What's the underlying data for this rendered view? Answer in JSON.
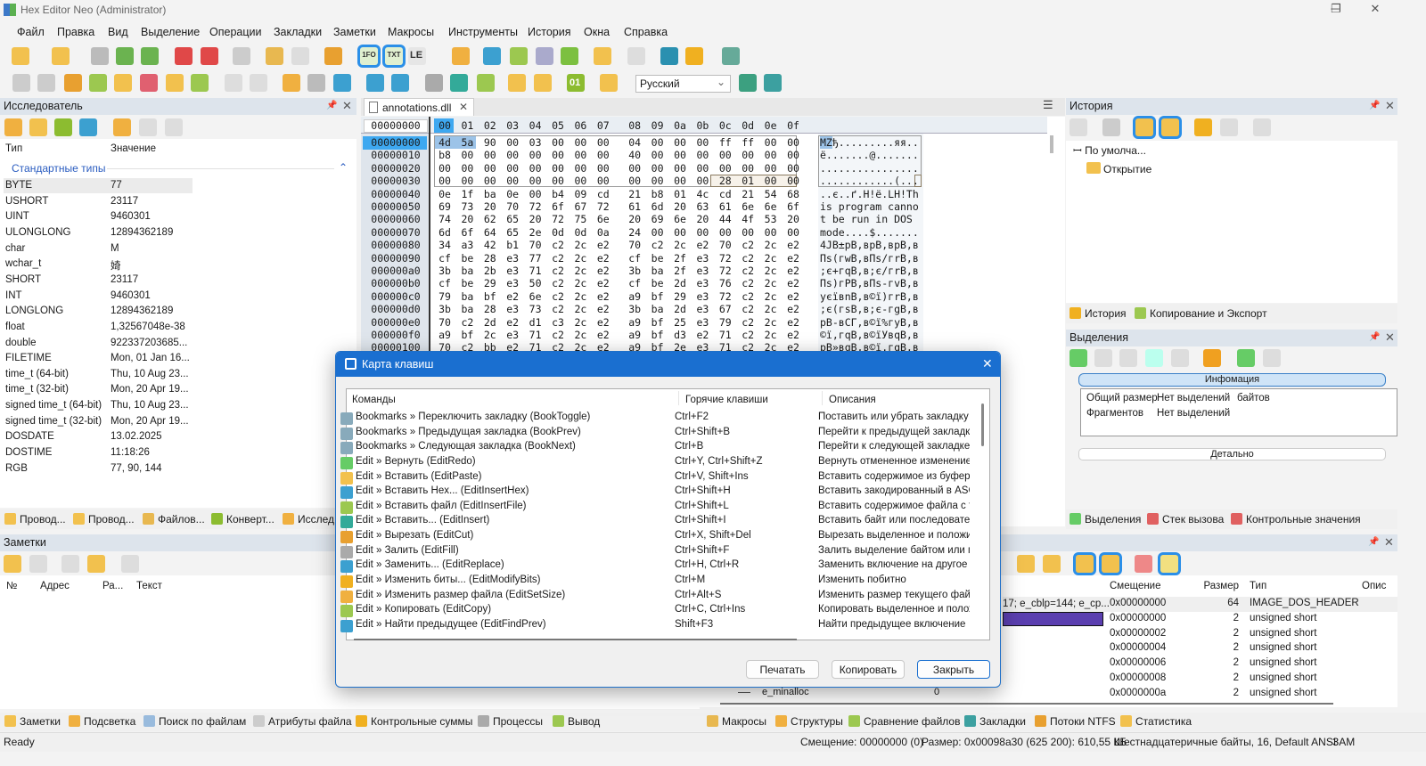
{
  "window": {
    "title": "Hex Editor Neo (Administrator)",
    "minimize": "─",
    "maximize": "❐",
    "close": "✕"
  },
  "menu": [
    "Файл",
    "Правка",
    "Вид",
    "Выделение",
    "Операции",
    "Закладки",
    "Заметки",
    "Макросы",
    "Инструменты",
    "История",
    "Окна",
    "Справка"
  ],
  "toolbar": {
    "language": "Русский",
    "chevron": "⌄",
    "btn_1fo": "1FO",
    "btn_txt": "TXT",
    "btn_le": "LE",
    "btn_bits": "01"
  },
  "explorer": {
    "title": "Исследователь",
    "col_type": "Тип",
    "col_value": "Значение",
    "group": "Стандартные типы",
    "collapse": "⌃",
    "rows": [
      [
        "BYTE",
        "77"
      ],
      [
        "USHORT",
        "23117"
      ],
      [
        "UINT",
        "9460301"
      ],
      [
        "ULONGLONG",
        "12894362189"
      ],
      [
        "char",
        "M"
      ],
      [
        "wchar_t",
        "婍"
      ],
      [
        "SHORT",
        "23117"
      ],
      [
        "INT",
        "9460301"
      ],
      [
        "LONGLONG",
        "12894362189"
      ],
      [
        "float",
        "1,32567048e-38"
      ],
      [
        "double",
        "922337203685..."
      ],
      [
        "FILETIME",
        "Mon, 01 Jan 16..."
      ],
      [
        "time_t (64-bit)",
        "Thu, 10 Aug 23..."
      ],
      [
        "time_t (32-bit)",
        "Mon, 20 Apr 19..."
      ],
      [
        "signed time_t (64-bit)",
        "Thu, 10 Aug 23..."
      ],
      [
        "signed time_t (32-bit)",
        "Mon, 20 Apr 19..."
      ],
      [
        "DOSDATE",
        "13.02.2025"
      ],
      [
        "DOSTIME",
        "11:18:26"
      ],
      [
        "RGB",
        "77, 90, 144"
      ]
    ],
    "tabs": [
      "Провод...",
      "Провод...",
      "Файлов...",
      "Конверт...",
      "Исслед"
    ]
  },
  "notes": {
    "title": "Заметки",
    "cols": [
      "№",
      "Адрес",
      "Ра...",
      "Текст"
    ]
  },
  "editor": {
    "tab": "annotations.dll",
    "tab_close": "✕",
    "offset_header": "00000000",
    "col_headers": [
      "00",
      "01",
      "02",
      "03",
      "04",
      "05",
      "06",
      "07",
      "08",
      "09",
      "0a",
      "0b",
      "0c",
      "0d",
      "0e",
      "0f"
    ],
    "rows": [
      [
        "00000000",
        "4d 5a 90 00 03 00 00 00 04 00 00 00 ff ff 00 00",
        "MZђ.........яя.."
      ],
      [
        "00000010",
        "b8 00 00 00 00 00 00 00 40 00 00 00 00 00 00 00",
        "ё.......@......."
      ],
      [
        "00000020",
        "00 00 00 00 00 00 00 00 00 00 00 00 00 00 00 00",
        "................"
      ],
      [
        "00000030",
        "00 00 00 00 00 00 00 00 00 00 00 00 28 01 00 00",
        "............(..."
      ],
      [
        "00000040",
        "0e 1f ba 0e 00 b4 09 cd 21 b8 01 4c cd 21 54 68",
        "..є..ґ.Н!ё.LН!Th"
      ],
      [
        "00000050",
        "69 73 20 70 72 6f 67 72 61 6d 20 63 61 6e 6e 6f",
        "is program canno"
      ],
      [
        "00000060",
        "74 20 62 65 20 72 75 6e 20 69 6e 20 44 4f 53 20",
        "t be run in DOS "
      ],
      [
        "00000070",
        "6d 6f 64 65 2e 0d 0d 0a 24 00 00 00 00 00 00 00",
        "mode....$......."
      ],
      [
        "00000080",
        "34 a3 42 b1 70 c2 2c e2 70 c2 2c e2 70 c2 2c e2",
        "4ЈB±pВ,вpВ,вpВ,в"
      ],
      [
        "00000090",
        "cf be 28 e3 77 c2 2c e2 cf be 2f e3 72 c2 2c e2",
        "Пѕ(гwВ,вПѕ/гrВ,в"
      ],
      [
        "000000a0",
        "3b ba 2b e3 71 c2 2c e2 3b ba 2f e3 72 c2 2c e2",
        ";є+гqВ,в;є/гrВ,в"
      ],
      [
        "000000b0",
        "cf be 29 e3 50 c2 2c e2 cf be 2d e3 76 c2 2c e2",
        "Пѕ)гPВ,вПѕ-гvВ,в"
      ],
      [
        "000000c0",
        "79 ba bf e2 6e c2 2c e2 a9 bf 29 e3 72 c2 2c e2",
        "yєївnВ,в©ї)гrВ,в"
      ],
      [
        "000000d0",
        "3b ba 28 e3 73 c2 2c e2 3b ba 2d e3 67 c2 2c e2",
        ";є(гsВ,в;є-гgВ,в"
      ],
      [
        "000000e0",
        "70 c2 2d e2 d1 c3 2c e2 a9 bf 25 e3 79 c2 2c e2",
        "pВ-вСГ,в©ї%гyВ,в"
      ],
      [
        "000000f0",
        "a9 bf 2c e3 71 c2 2c e2 a9 bf d3 e2 71 c2 2c e2",
        "©ї,гqВ,в©їУвqВ,в"
      ],
      [
        "00000100",
        "70 c2 bb e2 71 c2 2c e2 a9 bf 2e e3 71 c2 2c e2",
        "pВ»вqВ,в©ї.гqВ,в"
      ]
    ]
  },
  "history": {
    "title": "История",
    "root": "По умолча...",
    "item": "Открытие",
    "tabs": [
      "История",
      "Копирование и Экспорт"
    ]
  },
  "selections": {
    "title": "Выделения",
    "info": "Инфомация",
    "rows": [
      [
        "Общий размер",
        "Нет выделений",
        "байтов"
      ],
      [
        "Фрагментов",
        "Нет выделений",
        ""
      ]
    ],
    "detail": "Детально",
    "tabs": [
      "Выделения",
      "Стек вызова",
      "Контрольные значения"
    ]
  },
  "structures": {
    "cols": [
      "Смещение",
      "Размер",
      "Тип",
      "Опис"
    ],
    "first_value": "17; e_cblp=144; e_cp...",
    "hidden_name": "e_minalloc",
    "hidden_value": "0",
    "rows": [
      [
        "0x00000000",
        "64",
        "IMAGE_DOS_HEADER"
      ],
      [
        "0x00000000",
        "2",
        "unsigned short"
      ],
      [
        "0x00000002",
        "2",
        "unsigned short"
      ],
      [
        "0x00000004",
        "2",
        "unsigned short"
      ],
      [
        "0x00000006",
        "2",
        "unsigned short"
      ],
      [
        "0x00000008",
        "2",
        "unsigned short"
      ],
      [
        "0x0000000a",
        "2",
        "unsigned short"
      ]
    ]
  },
  "bottom_tabs_left": [
    "Заметки",
    "Подсветка",
    "Поиск по файлам",
    "Атрибуты файла",
    "Контрольные суммы",
    "Процессы",
    "Вывод"
  ],
  "bottom_tabs_right": [
    "Макросы",
    "Структуры",
    "Сравнение файлов",
    "Закладки",
    "Потоки NTFS",
    "Статистика"
  ],
  "status": {
    "left": "Ready",
    "offset": "Смещение: 00000000 (0)",
    "size": "Размер: 0x00098a30 (625 200): 610,55 КБ",
    "mode": "Шестнадцатеричные байты, 16, Default ANSI",
    "ins": "ЗАМ"
  },
  "dialog": {
    "title": "Карта клавиш",
    "close": "✕",
    "cols": [
      "Команды",
      "Горячие клавиши",
      "Описания"
    ],
    "rows": [
      [
        "Bookmarks » Переключить закладку (BookToggle)",
        "Ctrl+F2",
        "Поставить или убрать закладку"
      ],
      [
        "Bookmarks » Предыдущая закладка (BookPrev)",
        "Ctrl+Shift+B",
        "Перейти к предыдущей закладк"
      ],
      [
        "Bookmarks » Следующая закладка (BookNext)",
        "Ctrl+B",
        "Перейти к следующей закладке"
      ],
      [
        "Edit » Вернуть (EditRedo)",
        "Ctrl+Y, Ctrl+Shift+Z",
        "Вернуть отмененное изменение"
      ],
      [
        "Edit » Вставить (EditPaste)",
        "Ctrl+V, Shift+Ins",
        "Вставить содержимое из буфера"
      ],
      [
        "Edit » Вставить Hex... (EditInsertHex)",
        "Ctrl+Shift+H",
        "Вставить закодированный в ASC"
      ],
      [
        "Edit » Вставить файл (EditInsertFile)",
        "Ctrl+Shift+L",
        "Вставить содержимое файла с те"
      ],
      [
        "Edit » Вставить... (EditInsert)",
        "Ctrl+Shift+I",
        "Вставить байт или последовате"
      ],
      [
        "Edit » Вырезать (EditCut)",
        "Ctrl+X, Shift+Del",
        "Вырезать выделенное и положи"
      ],
      [
        "Edit » Залить (EditFill)",
        "Ctrl+Shift+F",
        "Залить выделение байтом или п"
      ],
      [
        "Edit » Заменить... (EditReplace)",
        "Ctrl+H, Ctrl+R",
        "Заменить включение на другое"
      ],
      [
        "Edit » Изменить биты... (EditModifyBits)",
        "Ctrl+M",
        "Изменить побитно"
      ],
      [
        "Edit » Изменить размер файла (EditSetSize)",
        "Ctrl+Alt+S",
        "Изменить размер текущего файл"
      ],
      [
        "Edit » Копировать (EditCopy)",
        "Ctrl+C, Ctrl+Ins",
        "Копировать выделенное и полож"
      ],
      [
        "Edit » Найти предыдущее (EditFindPrev)",
        "Shift+F3",
        "Найти предыдущее включение"
      ]
    ],
    "buttons": {
      "print": "Печатать",
      "copy": "Копировать",
      "close": "Закрыть"
    }
  },
  "colors": {
    "accent": "#1a6fd0",
    "selection": "#9cc3e8",
    "panel_header": "#dde4ec",
    "struct_bar": "#5b3fb0"
  }
}
